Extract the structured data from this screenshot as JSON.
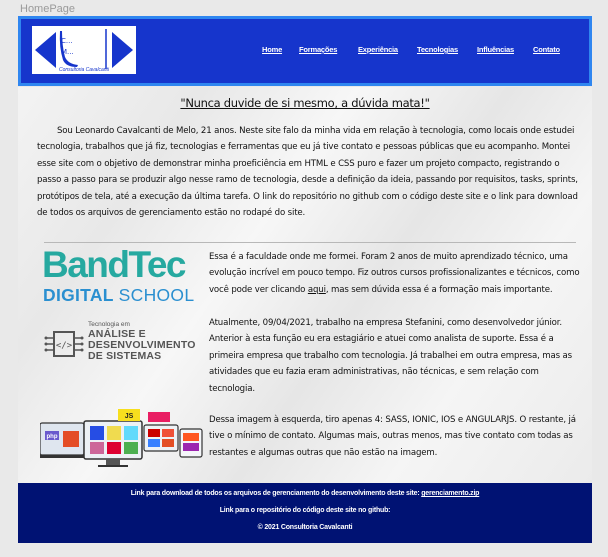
{
  "page_label": "HomePage",
  "logo": {
    "line1": "C...",
    "line2": "M...",
    "caption": "Consultoria Cavalcanti"
  },
  "nav": {
    "items": [
      "Home",
      "Formações",
      "Experiência",
      "Tecnologias",
      "Influências",
      "Contato"
    ]
  },
  "main": {
    "quote": "\"Nunca duvide de si mesmo, a dúvida mata!\"",
    "intro": "Sou Leonardo Cavalcanti de Melo, 21 anos. Neste site falo da minha vida em relação à tecnologia, como locais onde estudei tecnologia, trabalhos que já fiz, tecnologias e ferramentas que eu já tive contato e pessoas públicas que eu acompanho. Montei esse site com o objetivo de demonstrar minha proeficiência em HTML e CSS puro e fazer um projeto compacto, registrando o passo a passo para se produzir algo nesse ramo de tecnologia, desde a definição da ideia, passando por requisitos, tasks, sprints, protótipos de tela, até a execução da última tarefa. O link do repositório no github com o código deste site e o link para download de todos os arquivos de gerenciamento estão no rodapé do site.",
    "bandtec": {
      "logo_big": "BandTec",
      "logo_digital": "DIGITAL",
      "logo_school": "SCHOOL",
      "text_before": "Essa é a faculdade onde me formei. Foram 2 anos de muito aprendizado técnico, uma evolução incrível em pouco tempo. Fiz outros cursos profissionalizantes e técnicos, como você pode ver clicando ",
      "link": "aqui",
      "text_after": ", mas sem dúvida essa é a formação mais importante."
    },
    "ads": {
      "logo_top": "Tecnologia em",
      "logo_line1": "ANÁLISE E",
      "logo_line2": "DESENVOLVIMENTO",
      "logo_line3": "DE SISTEMAS",
      "text": "Atualmente, 09/04/2021, trabalho na empresa Stefanini, como desenvolvedor júnior. Anterior à esta função eu era estagiário e atuei como analista de suporte. Essa é a primeira empresa que trabalho com tecnologia. Já trabalhei em outra empresa, mas as atividades que eu fazia eram administrativas, não técnicas, e sem relação com tecnologia."
    },
    "tech": {
      "text": "Dessa imagem à esquerda, tiro apenas 4: SASS, IONIC, IOS e ANGULARJS. O restante, já tive o mínimo de contato. Algumas mais, outras menos, mas tive contato com todas as restantes e algumas outras que não estão na imagem."
    }
  },
  "footer": {
    "line1_text": "Link para download de todos os arquivos de gerenciamento do desenvolvimento deste site: ",
    "line1_link": "gerenciamento.zip",
    "line2_text": "Link para o repositório do código deste site no github:",
    "line3": "© 2021 Consultoria Cavalcanti"
  },
  "colors": {
    "header_bg": "#1635cc",
    "header_border": "#2f86f0",
    "footer_bg": "#001273",
    "bandtec_teal": "#26a9a0",
    "bandtec_blue": "#2a8fd0"
  }
}
